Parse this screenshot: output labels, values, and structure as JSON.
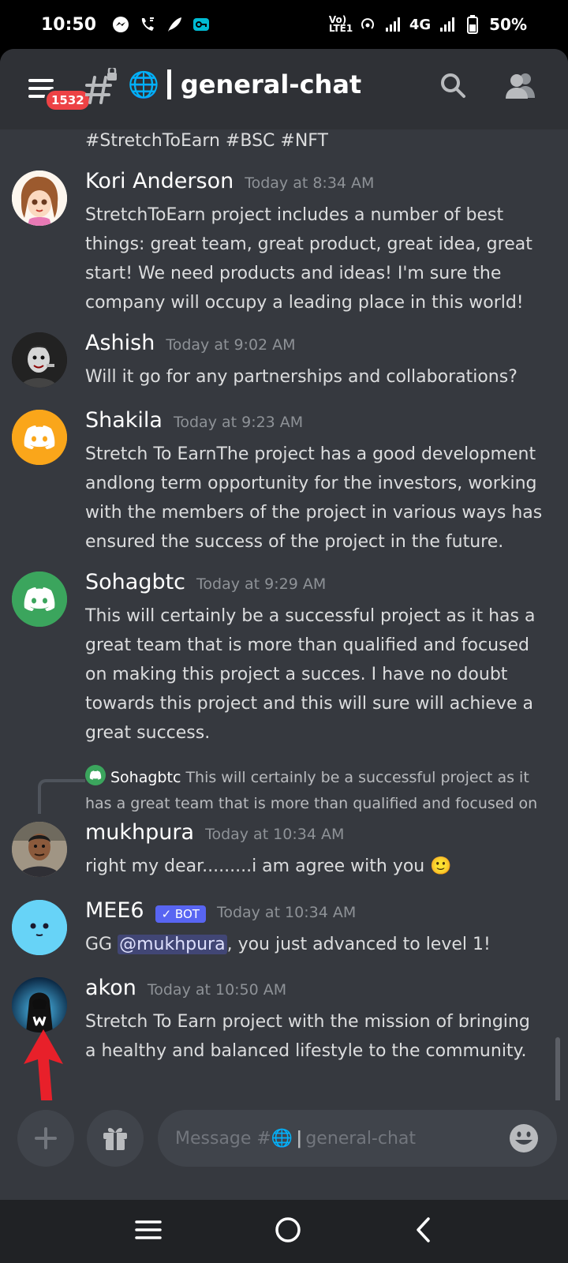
{
  "status_bar": {
    "time": "10:50",
    "network": "4G",
    "volte": "Vo) LTE1",
    "battery": "50%"
  },
  "header": {
    "badge_count": "1532",
    "globe": "🌐",
    "channel_name": "general-chat"
  },
  "messages": {
    "tag_line": "#StretchToEarn #BSC #NFT",
    "items": [
      {
        "author": "Kori Anderson",
        "timestamp": "Today at 8:34 AM",
        "text": "StretchToEarn project includes a number of best things: great team, great product, great idea, great start! We need products and ideas! I'm sure the company will occupy a leading place in this world!"
      },
      {
        "author": "Ashish",
        "timestamp": "Today at 9:02 AM",
        "text": "Will it go for any partnerships and collaborations?"
      },
      {
        "author": "Shakila",
        "timestamp": "Today at 9:23 AM",
        "text": "Stretch To EarnThe project has a good development andlong term opportunity for the investors, working with the members of the project in various ways has ensured the success of the project in the future."
      },
      {
        "author": "Sohagbtc",
        "timestamp": "Today at 9:29 AM",
        "text": "This will certainly be a successful project as it has a great team that is more than qualified and focused on making this project a succes. I have no doubt towards this project and this will sure will achieve a great success."
      },
      {
        "reply_author": "Sohagbtc",
        "reply_text": "This will certainly be a successful project as it has a great team that is more than qualified and focused on",
        "author": "mukhpura",
        "timestamp": "Today at 10:34 AM",
        "text": "right my dear.........i am agree with you",
        "emoji": "🙂"
      },
      {
        "author": "MEE6",
        "bot_tag": "✓ BOT",
        "timestamp": "Today at 10:34 AM",
        "text_before": "GG ",
        "mention": "@mukhpura",
        "text_after": ", you just advanced to level 1!"
      },
      {
        "author": "akon",
        "timestamp": "Today at 10:50 AM",
        "text": "Stretch To Earn project with the mission of bringing a healthy and balanced lifestyle to the community."
      }
    ]
  },
  "composer": {
    "placeholder_prefix": "Message #",
    "placeholder_globe": "🌐",
    "placeholder_bar": "|",
    "placeholder_channel": "general-chat"
  },
  "colors": {
    "background": "#36393f",
    "header": "#2f3136",
    "blurple": "#5865f2",
    "discord_orange": "#faa61a",
    "discord_green": "#3ba55d",
    "red_arrow": "#e8202a"
  }
}
